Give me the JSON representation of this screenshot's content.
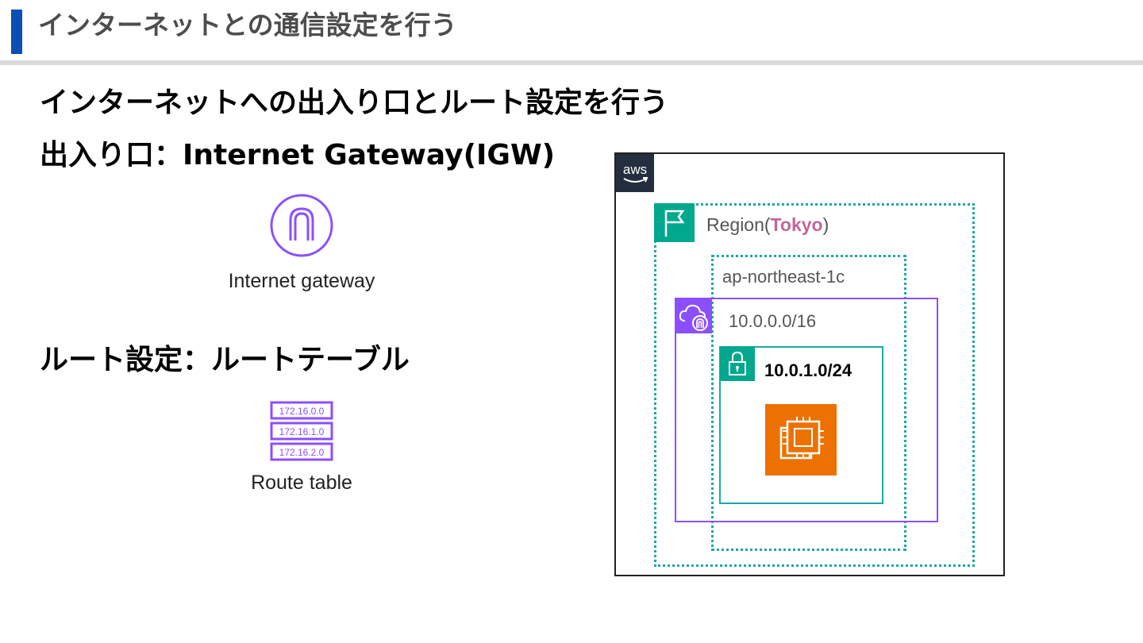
{
  "header": {
    "title": "インターネットとの通信設定を行う"
  },
  "main": {
    "subtitle": "インターネットへの出入り口とルート設定を行う",
    "igw_heading": "出入り口：Internet Gateway(IGW)",
    "igw_caption": "Internet gateway",
    "route_heading": "ルート設定：ルートテーブル",
    "route_rows": [
      "172.16.0.0",
      "172.16.1.0",
      "172.16.2.0"
    ],
    "route_caption": "Route table"
  },
  "diagram": {
    "aws_logo_text": "aws",
    "region_prefix": "Region(",
    "region_name": "Tokyo",
    "region_suffix": ")",
    "az_label": "ap-northeast-1c",
    "vpc_cidr": "10.0.0.0/16",
    "subnet_cidr": "10.0.1.0/24"
  },
  "colors": {
    "header_accent": "#0a4fb4",
    "teal": "#01a88d",
    "vpc_purple": "#8c4fff",
    "ec2_orange": "#ed7100",
    "tokyo_pink": "#c2659a"
  }
}
